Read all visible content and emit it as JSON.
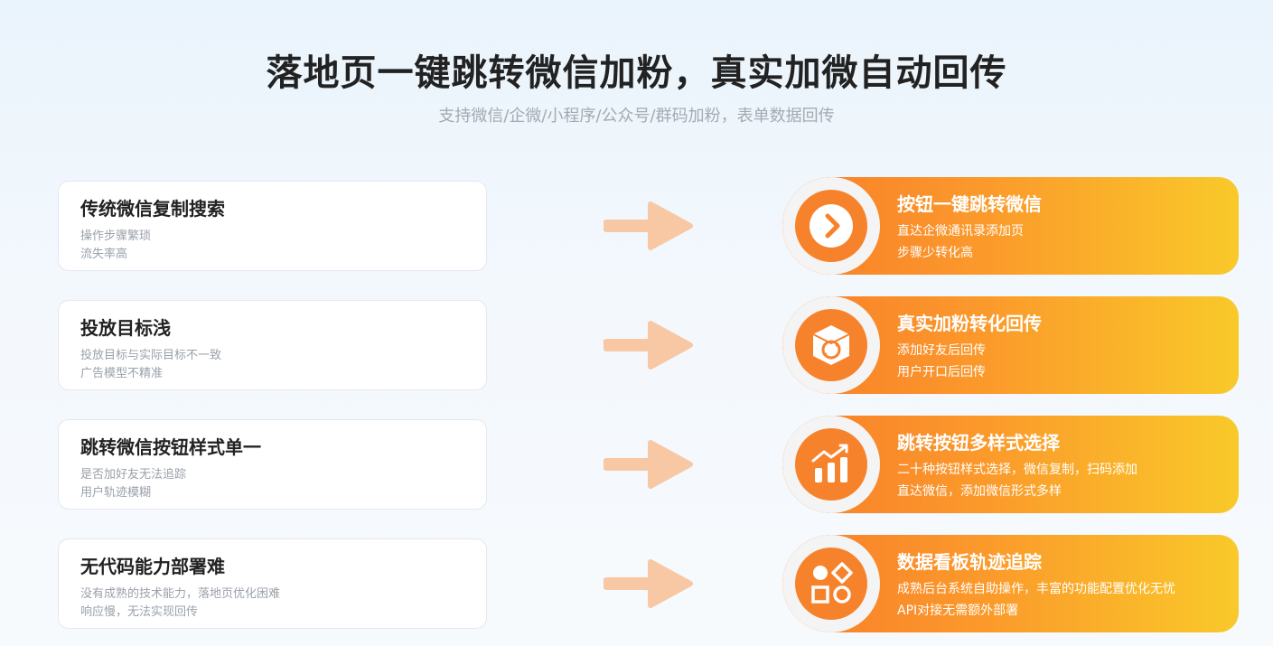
{
  "header": {
    "title": "落地页一键跳转微信加粉，真实加微自动回传",
    "subtitle": "支持微信/企微/小程序/公众号/群码加粉，表单数据回传"
  },
  "problems": [
    {
      "title": "传统微信复制搜索",
      "line1": "操作步骤繁琐",
      "line2": "流失率高"
    },
    {
      "title": "投放目标浅",
      "line1": "投放目标与实际目标不一致",
      "line2": "广告模型不精准"
    },
    {
      "title": "跳转微信按钮样式单一",
      "line1": "是否加好友无法追踪",
      "line2": "用户轨迹模糊"
    },
    {
      "title": "无代码能力部署难",
      "line1": "没有成熟的技术能力，落地页优化困难",
      "line2": "响应慢，无法实现回传"
    }
  ],
  "solutions": [
    {
      "title": "按钮一键跳转微信",
      "line1": "直达企微通讯录添加页",
      "line2": "步骤少转化高",
      "icon": "chevron-right-icon"
    },
    {
      "title": "真实加粉转化回传",
      "line1": "添加好友后回传",
      "line2": "用户开口后回传",
      "icon": "sync-box-icon"
    },
    {
      "title": "跳转按钮多样式选择",
      "line1": "二十种按钮样式选择，微信复制，扫码添加",
      "line2": "直达微信，添加微信形式多样",
      "icon": "bar-chart-icon"
    },
    {
      "title": "数据看板轨迹追踪",
      "line1": "成熟后台系统自助操作，丰富的功能配置优化无忧",
      "line2": "API对接无需额外部署",
      "icon": "shapes-icon"
    }
  ],
  "colors": {
    "accent_start": "#f97d2a",
    "accent_end": "#f9c92a",
    "arrow": "#f7c8a3"
  }
}
